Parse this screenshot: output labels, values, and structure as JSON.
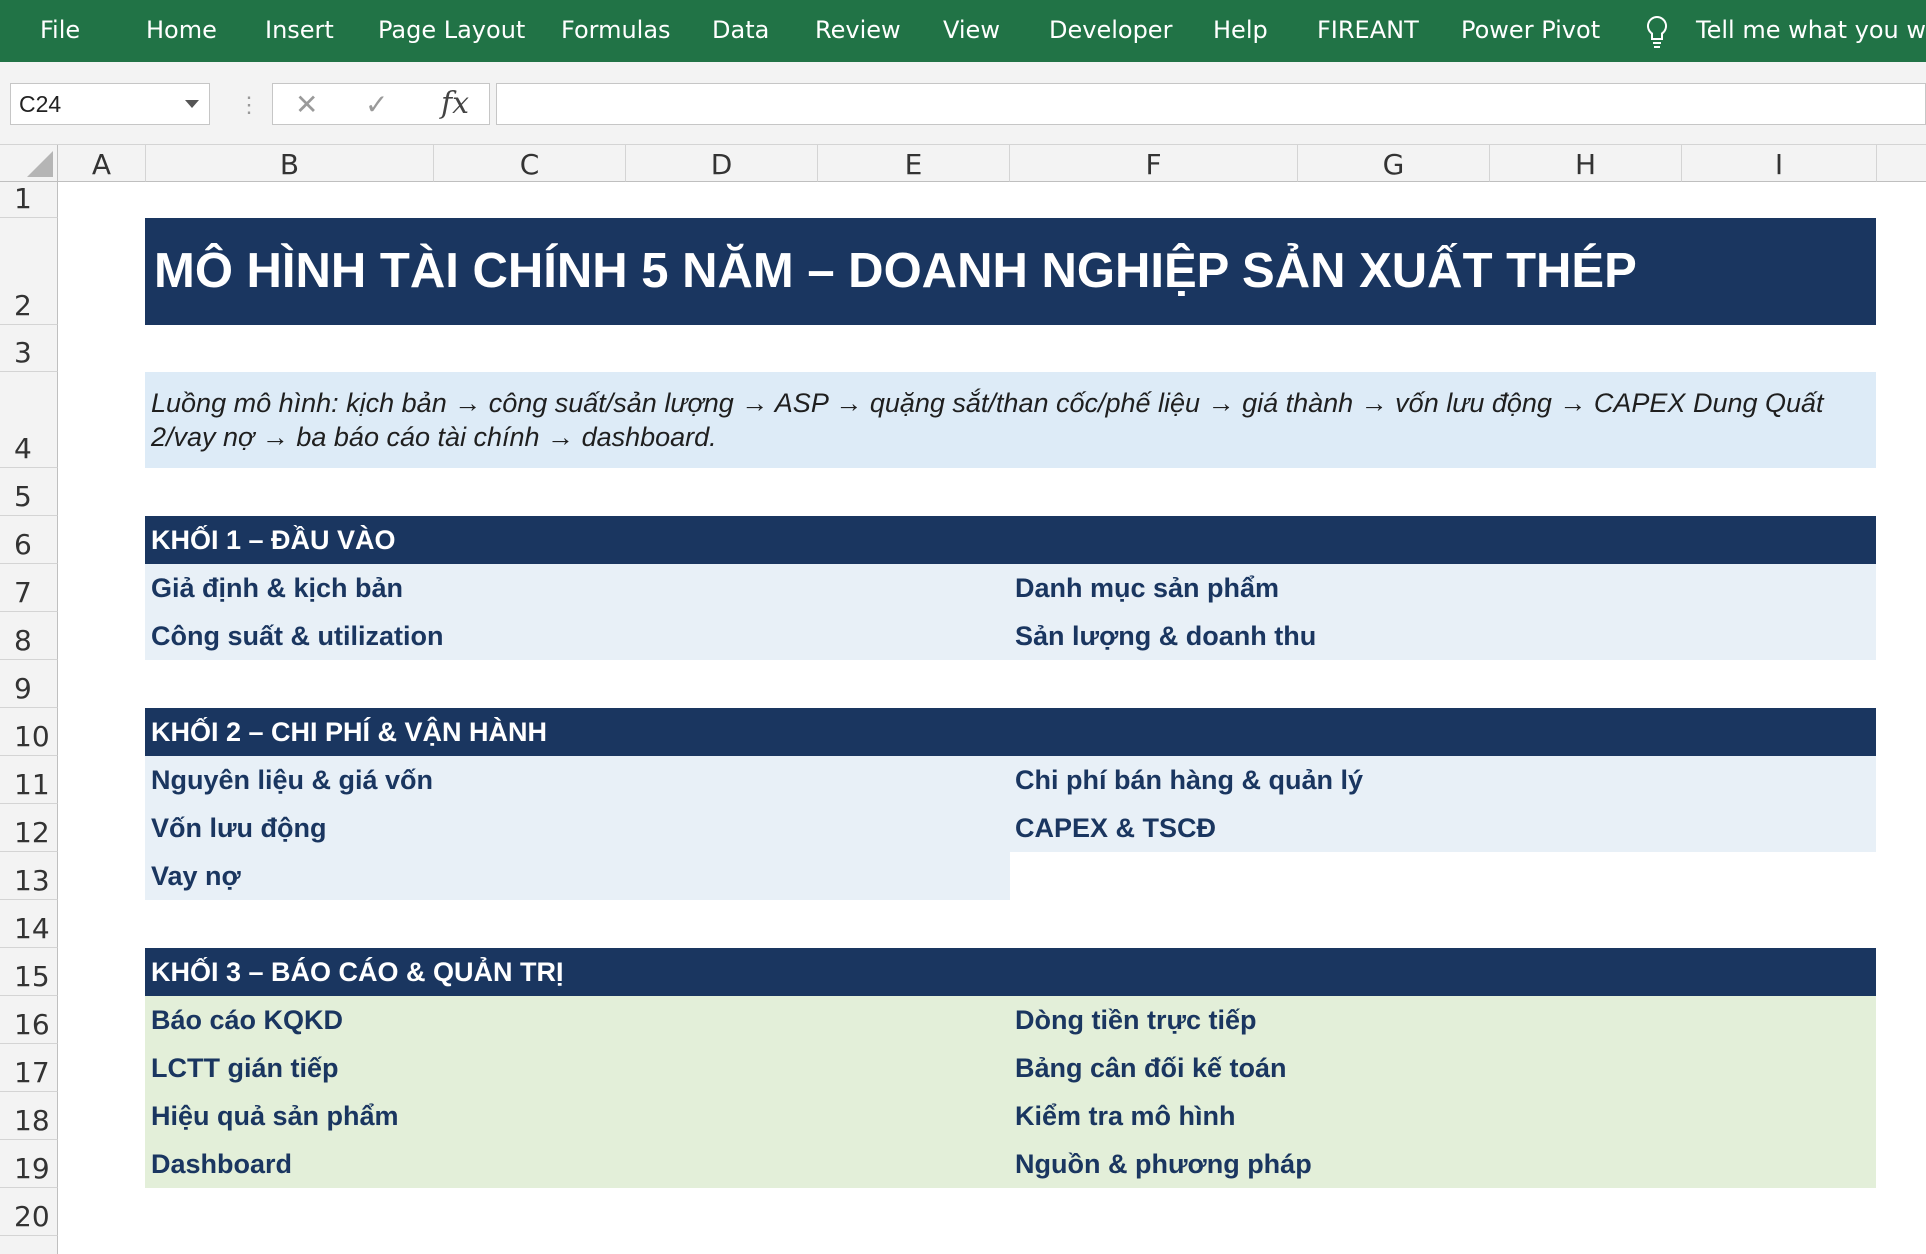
{
  "ribbon": {
    "tabs": [
      "File",
      "Home",
      "Insert",
      "Page Layout",
      "Formulas",
      "Data",
      "Review",
      "View",
      "Developer",
      "Help",
      "FIREANT",
      "Power Pivot"
    ],
    "tell_me": "Tell me what you war"
  },
  "formula_bar": {
    "name_box": "C24",
    "cancel_icon": "✕",
    "enter_icon": "✓",
    "fx_label": "fx",
    "formula": ""
  },
  "columns": [
    "A",
    "B",
    "C",
    "D",
    "E",
    "F",
    "G",
    "H",
    "I"
  ],
  "rows": [
    "1",
    "2",
    "3",
    "4",
    "5",
    "6",
    "7",
    "8",
    "9",
    "10",
    "11",
    "12",
    "13",
    "14",
    "15",
    "16",
    "17",
    "18",
    "19",
    "20"
  ],
  "sheet": {
    "title": "MÔ HÌNH TÀI CHÍNH 5 NĂM – DOANH NGHIỆP SẢN XUẤT THÉP",
    "note": "Luồng mô hình: kịch bản → công suất/sản lượng → ASP → quặng sắt/than cốc/phế liệu → giá thành → vốn lưu động → CAPEX Dung Quất 2/vay nợ → ba báo cáo tài chính → dashboard.",
    "block1": {
      "header": "KHỐI 1 – ĐẦU VÀO",
      "left": [
        "Giả định & kịch bản",
        "Công suất & utilization"
      ],
      "right": [
        "Danh mục sản phẩm",
        "Sản lượng & doanh thu"
      ]
    },
    "block2": {
      "header": "KHỐI 2 – CHI PHÍ & VẬN HÀNH",
      "left": [
        "Nguyên liệu & giá vốn",
        "Vốn lưu động",
        "Vay nợ"
      ],
      "right": [
        "Chi phí bán hàng & quản lý",
        "CAPEX & TSCĐ"
      ]
    },
    "block3": {
      "header": "KHỐI 3 – BÁO CÁO & QUẢN TRỊ",
      "left": [
        "Báo cáo KQKD",
        "LCTT gián tiếp",
        "Hiệu quả sản phẩm",
        "Dashboard"
      ],
      "right": [
        "Dòng tiền trực tiếp",
        "Bảng cân đối kế toán",
        "Kiểm tra mô hình",
        "Nguồn & phương pháp"
      ]
    }
  }
}
